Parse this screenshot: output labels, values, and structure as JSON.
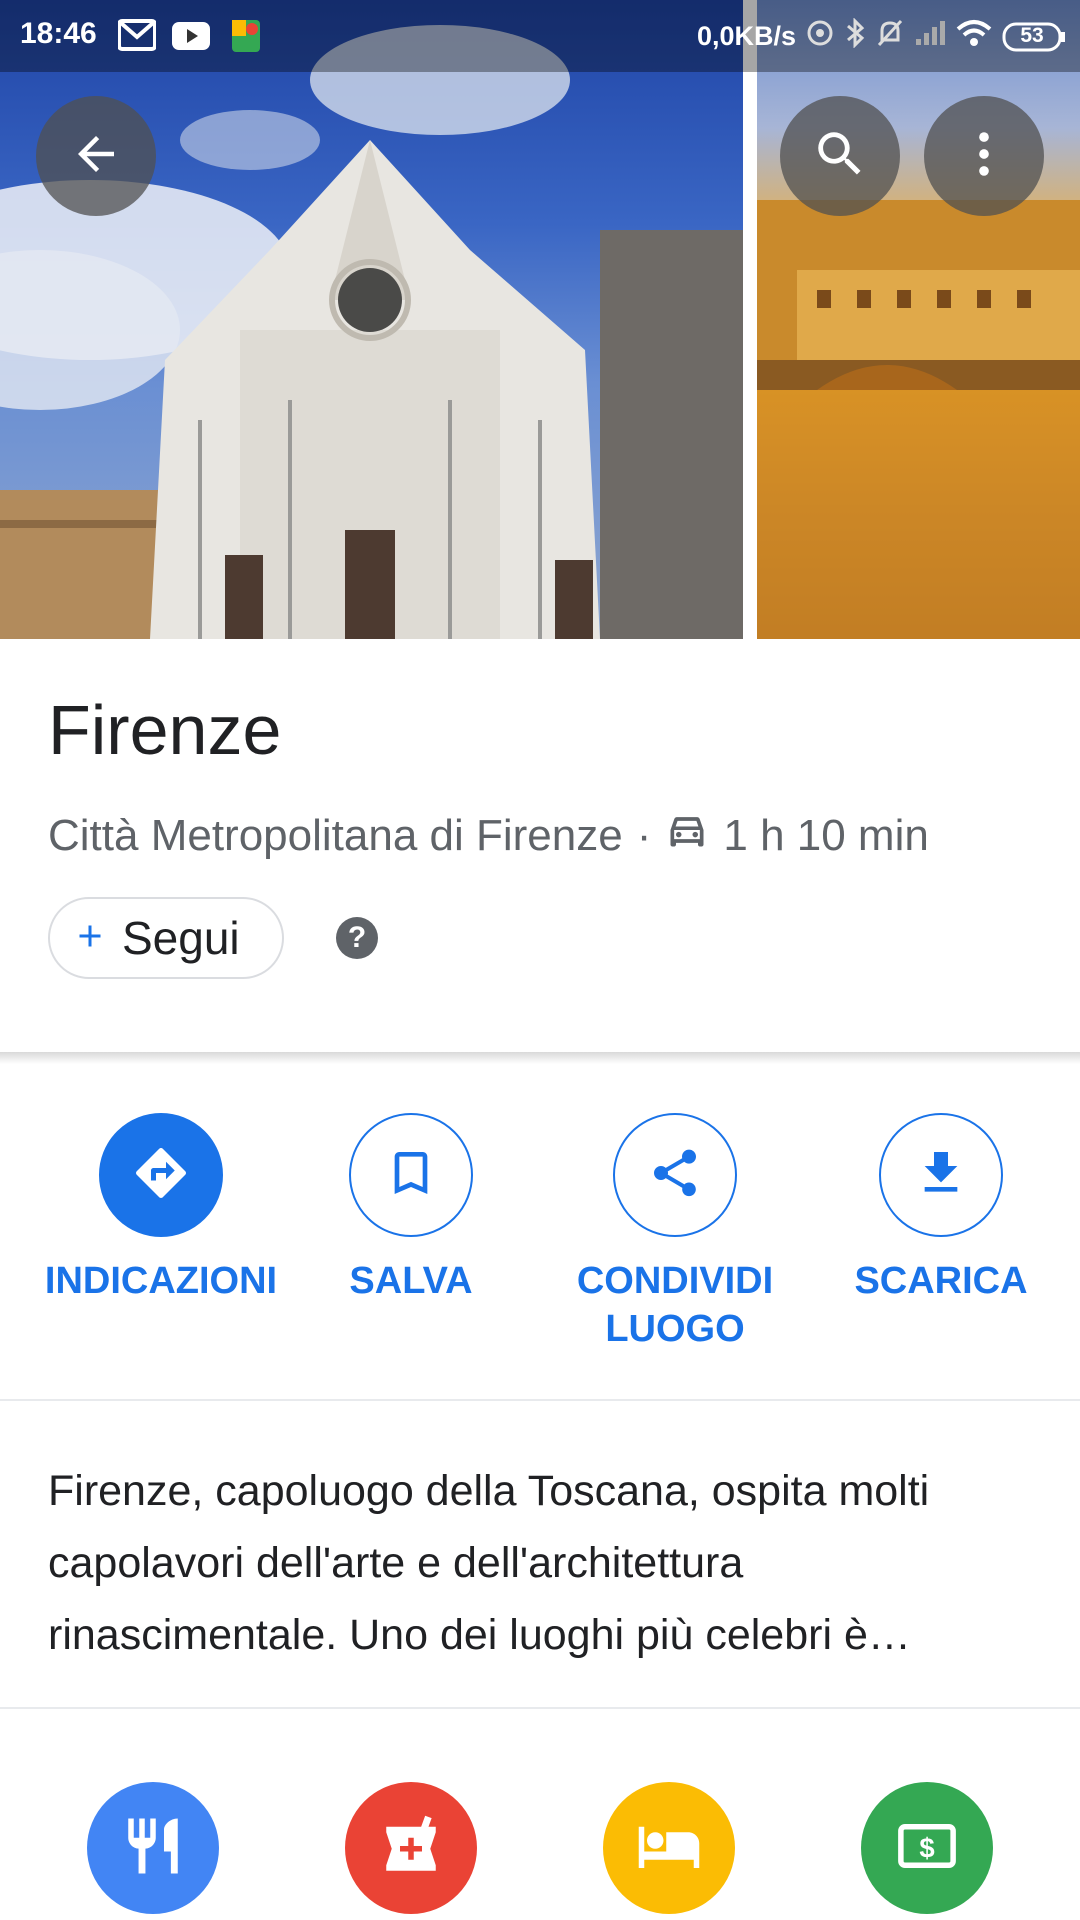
{
  "status_bar": {
    "time": "18:46",
    "net_speed": "0,0KB/s",
    "battery": "53"
  },
  "place": {
    "title": "Firenze",
    "region": "Città Metropolitana di Firenze",
    "separator": "·",
    "drive_time": "1 h 10 min",
    "follow_label": "Segui",
    "help_label": "?"
  },
  "actions": [
    {
      "label": "INDICAZIONI",
      "icon": "directions-icon"
    },
    {
      "label": "SALVA",
      "icon": "bookmark-icon"
    },
    {
      "label": "CONDIVIDI\nLUOGO",
      "icon": "share-icon"
    },
    {
      "label": "SCARICA",
      "icon": "download-icon"
    }
  ],
  "description": "Firenze, capoluogo della Toscana, ospita molti capolavori dell'arte e dell'architettura rinascimentale. Uno dei luoghi più celebri è…",
  "categories": [
    {
      "icon": "restaurant-icon",
      "color": "#4285f4"
    },
    {
      "icon": "pharmacy-icon",
      "color": "#ea4335"
    },
    {
      "icon": "hotel-icon",
      "color": "#fbbc04"
    },
    {
      "icon": "atm-icon",
      "color": "#34a853"
    }
  ],
  "colors": {
    "accent": "#1a73e8",
    "title": "#202124",
    "secondary": "#5f6368"
  }
}
